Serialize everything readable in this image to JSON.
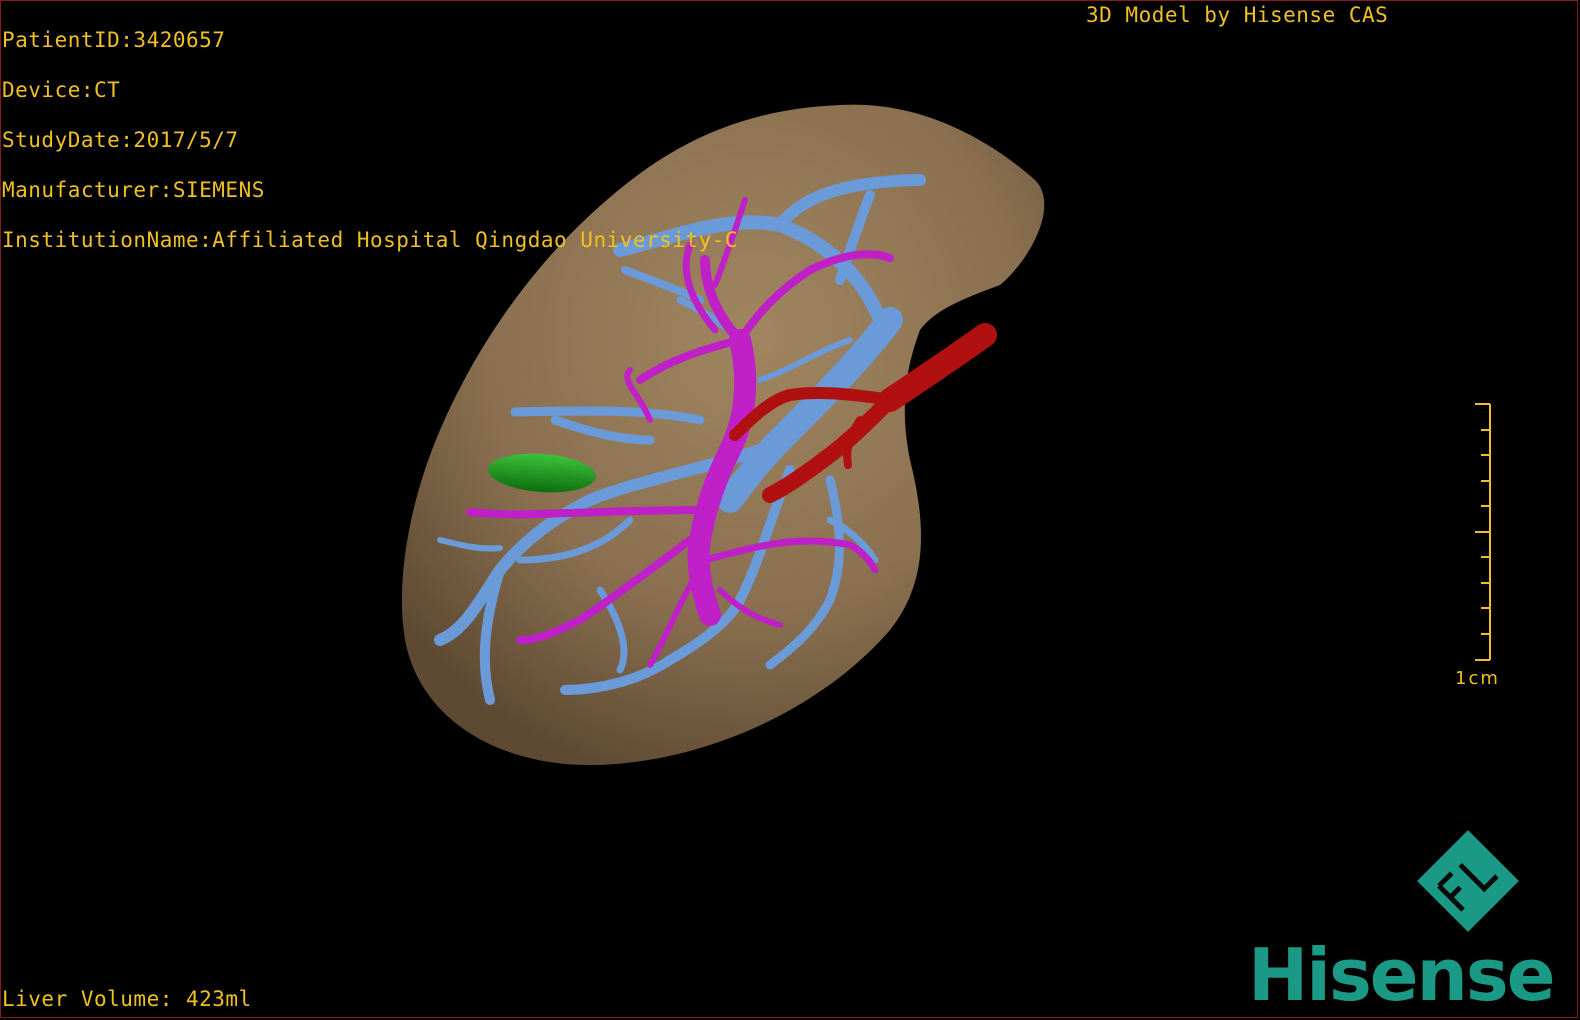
{
  "patient_info": {
    "patient_id": "PatientID:3420657",
    "device": "Device:CT",
    "study_date": "StudyDate:2017/5/7",
    "manufacturer": "Manufacturer:SIEMENS",
    "institution": "InstitutionName:Affiliated Hospital Qingdao University-C"
  },
  "brand_label": "3D Model by Hisense CAS",
  "liver_volume": "Liver Volume: 423ml",
  "scale_bar": {
    "label": "1cm"
  },
  "logo": {
    "wordmark": "Hisense",
    "badge_letters": "FL"
  },
  "colors": {
    "text": "#f0c020",
    "liver": "#8a7050",
    "portal_vein": "#6a9ad8",
    "hepatic_vein": "#c020c8",
    "artery": "#b01010",
    "gallbladder": "#1a9a1a",
    "logo": "#1a9a86"
  },
  "structures": [
    "liver",
    "portal-vein",
    "hepatic-vein",
    "hepatic-artery",
    "gallbladder"
  ]
}
